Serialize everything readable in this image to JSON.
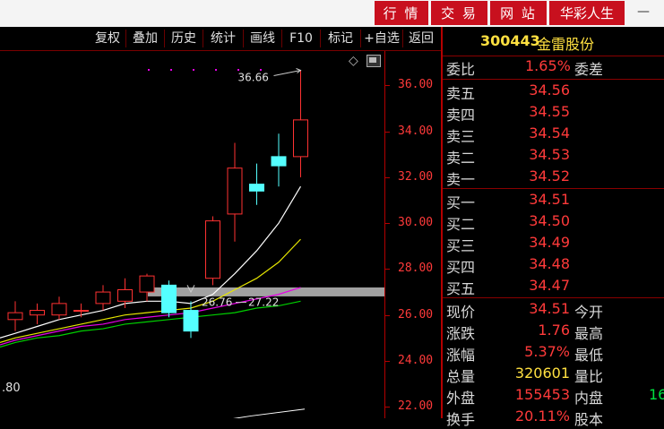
{
  "topnav": [
    {
      "label": "行 情"
    },
    {
      "label": "交 易"
    },
    {
      "label": "网 站"
    },
    {
      "label": "华彩人生"
    }
  ],
  "minimize": "—",
  "toolbar": [
    "复权",
    "叠加",
    "历史",
    "统计",
    "画线",
    "F10",
    "标记",
    "+自选",
    "返回"
  ],
  "chart": {
    "tick_labels": [
      "36.00",
      "34.00",
      "32.00",
      "30.00",
      "28.00",
      "26.00",
      "24.00",
      "22.00"
    ],
    "high_label": "36.66",
    "low_label_left": "26.76",
    "low_label_right": "27.22",
    "bottom_left_value": ".80"
  },
  "chart_data": {
    "type": "candlestick",
    "ylim": [
      21.5,
      37.5
    ],
    "candles": [
      {
        "o": 25.8,
        "c": 26.1,
        "h": 26.6,
        "l": 25.3
      },
      {
        "o": 26.0,
        "c": 26.2,
        "h": 26.5,
        "l": 25.6
      },
      {
        "o": 26.0,
        "c": 26.5,
        "h": 26.8,
        "l": 25.8
      },
      {
        "o": 26.2,
        "c": 26.2,
        "h": 26.5,
        "l": 25.9
      },
      {
        "o": 26.5,
        "c": 27.0,
        "h": 27.3,
        "l": 26.2
      },
      {
        "o": 26.6,
        "c": 27.1,
        "h": 27.6,
        "l": 26.3
      },
      {
        "o": 27.0,
        "c": 27.7,
        "h": 27.8,
        "l": 26.6
      },
      {
        "o": 27.3,
        "c": 26.1,
        "h": 27.5,
        "l": 25.9
      },
      {
        "o": 26.2,
        "c": 25.3,
        "h": 26.6,
        "l": 25.0
      },
      {
        "o": 27.6,
        "c": 30.1,
        "h": 30.3,
        "l": 27.3
      },
      {
        "o": 30.4,
        "c": 32.4,
        "h": 33.5,
        "l": 29.2
      },
      {
        "o": 31.7,
        "c": 31.4,
        "h": 32.6,
        "l": 30.8
      },
      {
        "o": 32.9,
        "c": 32.5,
        "h": 33.9,
        "l": 31.6
      },
      {
        "o": 32.9,
        "c": 34.5,
        "h": 36.66,
        "l": 32.0
      }
    ],
    "ma_series": [
      {
        "color": "#ffffff",
        "values": [
          25.2,
          25.5,
          25.8,
          26.0,
          26.2,
          26.5,
          26.6,
          26.6,
          26.5,
          26.9,
          27.8,
          28.8,
          30.0,
          31.6
        ]
      },
      {
        "color": "#e6e600",
        "values": [
          25.0,
          25.2,
          25.4,
          25.6,
          25.8,
          26.0,
          26.1,
          26.2,
          26.3,
          26.6,
          27.1,
          27.6,
          28.3,
          29.3
        ]
      },
      {
        "color": "#e600e6",
        "values": [
          24.9,
          25.1,
          25.3,
          25.5,
          25.6,
          25.8,
          25.9,
          26.0,
          26.1,
          26.3,
          26.5,
          26.7,
          26.9,
          27.2
        ]
      },
      {
        "color": "#00d000",
        "values": [
          24.8,
          25.0,
          25.1,
          25.3,
          25.4,
          25.6,
          25.7,
          25.8,
          25.9,
          26.0,
          26.1,
          26.3,
          26.4,
          26.6
        ]
      }
    ]
  },
  "quote": {
    "code": "300443",
    "name": "金雷股份",
    "webi_label": "委比",
    "webi_value": "1.65%",
    "weicha_label": "委差",
    "sell": [
      {
        "label": "卖五",
        "price": "34.56"
      },
      {
        "label": "卖四",
        "price": "34.55"
      },
      {
        "label": "卖三",
        "price": "34.54"
      },
      {
        "label": "卖二",
        "price": "34.53"
      },
      {
        "label": "卖一",
        "price": "34.52"
      }
    ],
    "buy": [
      {
        "label": "买一",
        "price": "34.51"
      },
      {
        "label": "买二",
        "price": "34.50"
      },
      {
        "label": "买三",
        "price": "34.49"
      },
      {
        "label": "买四",
        "price": "34.48"
      },
      {
        "label": "买五",
        "price": "34.47"
      }
    ],
    "stats": [
      {
        "label": "现价",
        "value": "34.51",
        "label2": "今开",
        "value2": ""
      },
      {
        "label": "涨跌",
        "value": "1.76",
        "label2": "最高",
        "value2": ""
      },
      {
        "label": "涨幅",
        "value": "5.37%",
        "label2": "最低",
        "value2": ""
      },
      {
        "label": "总量",
        "value": "320601",
        "label2": "量比",
        "value2": ""
      },
      {
        "label": "外盘",
        "value": "155453",
        "label2": "内盘",
        "value2": "16"
      },
      {
        "label": "换手",
        "value": "20.11%",
        "label2": "股本",
        "value2": ""
      }
    ]
  }
}
